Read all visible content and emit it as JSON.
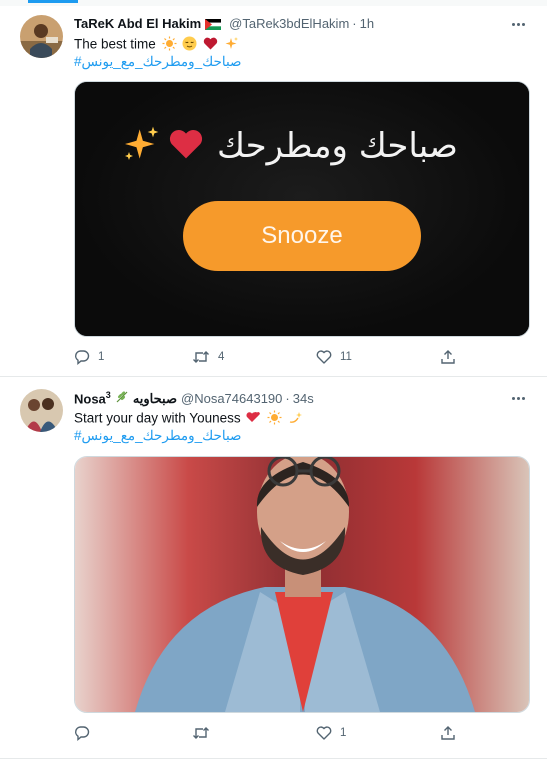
{
  "tweets": [
    {
      "name": "TaReK Abd El Hakim",
      "handle": "@TaRek3bdElHakim",
      "dot": "·",
      "time": "1h",
      "text": "The best time",
      "hashtag": "#صباحك_ومطرحك_مع_يونس",
      "media": {
        "arabic": "صباحك ومطرحك",
        "button_label": "Snooze"
      },
      "actions": {
        "reply": "1",
        "retweet": "4",
        "like": "11"
      }
    },
    {
      "name": "Nosa",
      "name_sup": "3",
      "name_arabic": "صبحاويه",
      "handle": "@Nosa74643190",
      "dot": "·",
      "time": "34s",
      "text": "Start your day with Youness",
      "hashtag": "#صباحك_ومطرحك_مع_يونس",
      "actions": {
        "reply": "",
        "retweet": "",
        "like": "1"
      }
    }
  ],
  "icons": {
    "reply": "reply-icon",
    "retweet": "retweet-icon",
    "like": "heart-icon",
    "share": "share-icon",
    "more": "more-icon"
  },
  "colors": {
    "accent": "#1d9bf0",
    "text": "#0f1419",
    "muted": "#536471",
    "snooze": "#f69a2b"
  }
}
